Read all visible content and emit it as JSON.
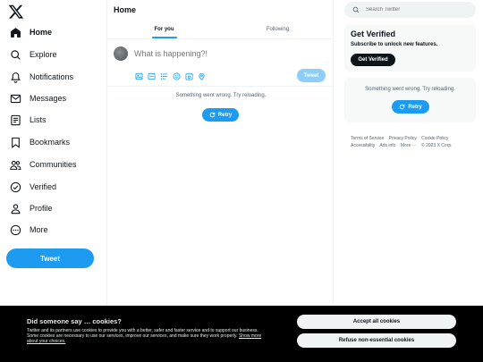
{
  "nav": {
    "items": [
      {
        "label": "Home",
        "icon": "home-icon"
      },
      {
        "label": "Explore",
        "icon": "search-icon"
      },
      {
        "label": "Notifications",
        "icon": "bell-icon"
      },
      {
        "label": "Messages",
        "icon": "mail-icon"
      },
      {
        "label": "Lists",
        "icon": "list-icon"
      },
      {
        "label": "Bookmarks",
        "icon": "bookmark-icon"
      },
      {
        "label": "Communities",
        "icon": "people-icon"
      },
      {
        "label": "Verified",
        "icon": "verified-icon"
      },
      {
        "label": "Profile",
        "icon": "person-icon"
      },
      {
        "label": "More",
        "icon": "more-circle-icon"
      }
    ],
    "tweet_label": "Tweet"
  },
  "main": {
    "title": "Home",
    "tabs": [
      {
        "label": "For you"
      },
      {
        "label": "Following"
      }
    ],
    "compose": {
      "placeholder": "What is happening?!",
      "tweet_label": "Tweet"
    },
    "error_text": "Something went wrong. Try reloading.",
    "retry_label": "Retry"
  },
  "sidebar": {
    "search_placeholder": "Search Twitter",
    "verified": {
      "title": "Get Verified",
      "subtitle": "Subscribe to unlock new features.",
      "button": "Get Verified"
    },
    "error_text": "Something went wrong. Try reloading.",
    "retry_label": "Retry",
    "footer": [
      "Terms of Service",
      "Privacy Policy",
      "Cookie Policy",
      "Accessibility",
      "Ads info",
      "More ···",
      "© 2023 X Corp."
    ]
  },
  "cookie": {
    "title": "Did someone say … cookies?",
    "text": "Twitter and its partners use cookies to provide you with a better, safer and faster service and to support our business. Some cookies are necessary to use our services, improve our services, and make sure they work properly.",
    "link": "Show more about your choices.",
    "accept": "Accept all cookies",
    "refuse": "Refuse non-essential cookies"
  },
  "colors": {
    "accent": "#1d9bf0",
    "text": "#0f1419",
    "muted": "#536471",
    "banner": "#000000"
  }
}
